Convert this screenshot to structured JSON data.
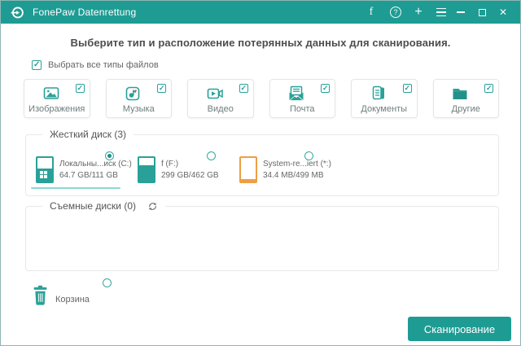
{
  "titlebar": {
    "app_title": "FonePaw Datenrettung",
    "facebook_label": "f",
    "help_label": "?",
    "plus_label": "+"
  },
  "header": {
    "instruction": "Выберите тип и расположение потерянных данных для сканирования."
  },
  "select_all": {
    "label": "Выбрать все типы файлов",
    "checked": true
  },
  "file_types": [
    {
      "label": "Изображения",
      "icon": "image-icon",
      "checked": true
    },
    {
      "label": "Музыка",
      "icon": "music-icon",
      "checked": true
    },
    {
      "label": "Видео",
      "icon": "video-icon",
      "checked": true
    },
    {
      "label": "Почта",
      "icon": "mail-icon",
      "checked": true
    },
    {
      "label": "Документы",
      "icon": "document-icon",
      "checked": true
    },
    {
      "label": "Другие",
      "icon": "folder-icon",
      "checked": true
    }
  ],
  "hard_disk_section": {
    "title": "Жесткий диск (3)",
    "disks": [
      {
        "name": "Локальны...иск (C:)",
        "capacity": "64.7 GB/111 GB",
        "selected": true,
        "used_percent": 55,
        "color": "teal"
      },
      {
        "name": "f (F:)",
        "capacity": "299 GB/462 GB",
        "selected": false,
        "used_percent": 68,
        "color": "teal"
      },
      {
        "name": "System-re...iert (*:)",
        "capacity": "34.4 MB/499 MB",
        "selected": false,
        "used_percent": 9,
        "color": "orange"
      }
    ]
  },
  "removable_section": {
    "title": "Съемные диски (0)"
  },
  "recycle_bin": {
    "label": "Корзина",
    "selected": false
  },
  "scan_button": {
    "label": "Сканирование"
  },
  "colors": {
    "accent_teal": "#1E9C94",
    "icon_teal": "#2AA198",
    "warning_orange": "#EE9E44",
    "selected_underline": "#8ED8D2",
    "music_note_accent": "#E2574C"
  }
}
